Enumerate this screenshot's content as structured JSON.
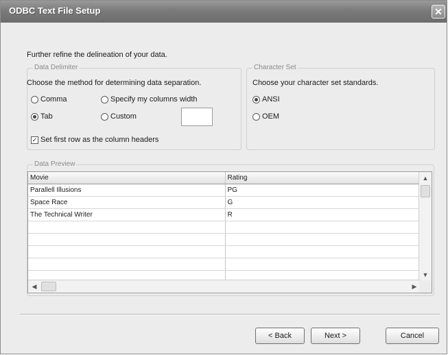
{
  "window": {
    "title": "ODBC Text File Setup",
    "close_glyph": "✕"
  },
  "intro": "Further refine the delineation of your data.",
  "delimiter": {
    "legend": "Data Delimiter",
    "description": "Choose the method for determining data separation.",
    "options": [
      {
        "label": "Comma",
        "selected": false
      },
      {
        "label": "Specify my columns width",
        "selected": false
      },
      {
        "label": "Tab",
        "selected": true
      },
      {
        "label": "Custom",
        "selected": false
      }
    ],
    "custom_value": "",
    "header_checkbox": {
      "label": "Set first row as the column headers",
      "checked": true,
      "glyph": "✓"
    }
  },
  "charset": {
    "legend": "Character Set",
    "description": "Choose your character set standards.",
    "options": [
      {
        "label": "ANSI",
        "selected": true
      },
      {
        "label": "OEM",
        "selected": false
      }
    ]
  },
  "preview": {
    "legend": "Data Preview",
    "columns": [
      "Movie",
      "Rating"
    ],
    "rows": [
      [
        "Parallell Illusions",
        "PG"
      ],
      [
        "Space Race",
        "G"
      ],
      [
        "The Technical Writer",
        "R"
      ],
      [
        "",
        ""
      ],
      [
        "",
        ""
      ],
      [
        "",
        ""
      ],
      [
        "",
        ""
      ],
      [
        "",
        ""
      ]
    ],
    "scroll_glyphs": {
      "up": "▲",
      "down": "▼",
      "left": "◀",
      "right": "▶"
    }
  },
  "buttons": {
    "back": "< Back",
    "next": "Next >",
    "cancel": "Cancel"
  }
}
